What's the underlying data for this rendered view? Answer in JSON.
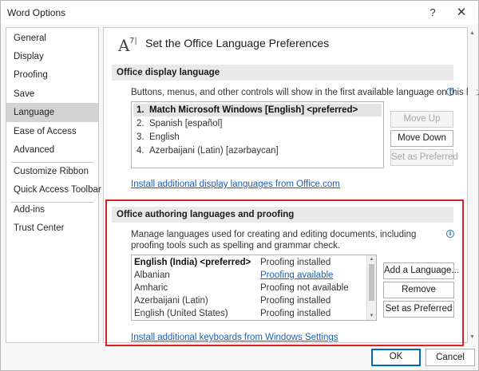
{
  "window": {
    "title": "Word Options",
    "help_glyph": "?",
    "close_glyph": "✕"
  },
  "nav": {
    "items": [
      "General",
      "Display",
      "Proofing",
      "Save",
      "Language",
      "Ease of Access",
      "Advanced",
      "Customize Ribbon",
      "Quick Access Toolbar",
      "Add-ins",
      "Trust Center"
    ],
    "selected": "Language"
  },
  "header": {
    "icon": "language-icon",
    "title": "Set the Office Language Preferences"
  },
  "display_language": {
    "heading": "Office display language",
    "description": "Buttons, menus, and other controls will show in the first available language on this list.",
    "languages": [
      {
        "num": "1.",
        "name": "Match Microsoft Windows [English] <preferred>"
      },
      {
        "num": "2.",
        "name": "Spanish [español]"
      },
      {
        "num": "3.",
        "name": "English"
      },
      {
        "num": "4.",
        "name": "Azerbaijani (Latin) [azərbaycan]"
      }
    ],
    "buttons": {
      "move_up": "Move Up",
      "move_down": "Move Down",
      "set_preferred": "Set as Preferred"
    },
    "install_link": "Install additional display languages from Office.com"
  },
  "authoring": {
    "heading": "Office authoring languages and proofing",
    "description": "Manage languages used for creating and editing documents, including proofing tools such as spelling and grammar check.",
    "languages": [
      {
        "name": "English (India) <preferred>",
        "status": "Proofing installed"
      },
      {
        "name": "Albanian",
        "status": "Proofing available"
      },
      {
        "name": "Amharic",
        "status": "Proofing not available"
      },
      {
        "name": "Azerbaijani (Latin)",
        "status": "Proofing installed"
      },
      {
        "name": "English (United States)",
        "status": "Proofing installed"
      }
    ],
    "buttons": {
      "add": "Add a Language...",
      "remove": "Remove",
      "set_preferred": "Set as Preferred"
    },
    "keyboards_link": "Install additional keyboards from Windows Settings"
  },
  "footer": {
    "ok": "OK",
    "cancel": "Cancel"
  },
  "colors": {
    "highlight": "#e01e26",
    "link": "#1f5fb0",
    "accent": "#0067c0"
  }
}
